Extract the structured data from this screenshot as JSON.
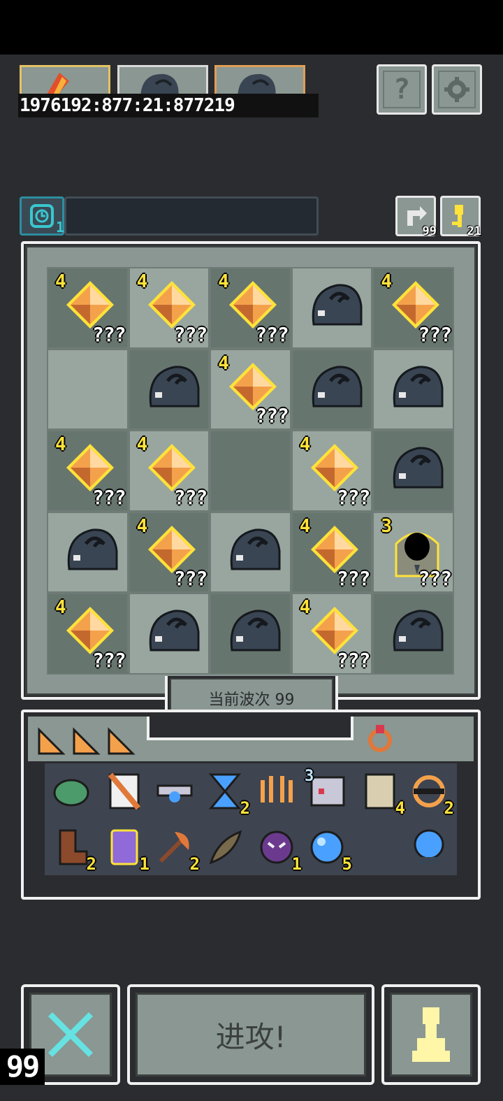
{
  "heroes": [
    {
      "name": "hero-red",
      "border": "#e3c266",
      "stat": "19761"
    },
    {
      "name": "hero-dark-1",
      "border": "#d9d9d9",
      "stat": "92:877"
    },
    {
      "name": "hero-dark-2",
      "border": "#e09e58",
      "stat": "21:877219"
    }
  ],
  "hero_stats_text": "1976192:877:21:877219",
  "help_label": "?",
  "timer": {
    "count": "1",
    "progress": 0.0
  },
  "resources": {
    "reroll": "99",
    "keys": "21"
  },
  "board": [
    [
      "gem",
      "gem",
      "gem",
      "slime",
      "gem"
    ],
    [
      "empty",
      "slime",
      "gem",
      "slime",
      "slime"
    ],
    [
      "gem",
      "gem",
      "empty",
      "gem",
      "slime"
    ],
    [
      "slime",
      "gem",
      "slime",
      "gem",
      "portal"
    ],
    [
      "gem",
      "slime",
      "slime",
      "gem",
      "slime"
    ]
  ],
  "gem_level": "4",
  "portal_level": "3",
  "unknown_label": "???",
  "wave_label": "当前波次 99",
  "inventory": {
    "row1": [
      {
        "icon": "turtle-shell-icon",
        "count": ""
      },
      {
        "icon": "flag-icon",
        "count": ""
      },
      {
        "icon": "goggles-icon",
        "count": ""
      },
      {
        "icon": "hourglass-icon",
        "count": "2"
      },
      {
        "icon": "claw-icon",
        "count": ""
      },
      {
        "icon": "book-icon",
        "count": "",
        "pre": "3"
      },
      {
        "icon": "map-icon",
        "count": "4"
      },
      {
        "icon": "shield-ring-icon",
        "count": "2"
      }
    ],
    "row2": [
      {
        "icon": "boot-icon",
        "count": "2"
      },
      {
        "icon": "potion-jar-icon",
        "count": "1"
      },
      {
        "icon": "axe-icon",
        "count": "2"
      },
      {
        "icon": "feather-icon",
        "count": ""
      },
      {
        "icon": "demon-mask-icon",
        "count": "1"
      },
      {
        "icon": "blue-orb-icon",
        "count": "5"
      },
      {
        "icon": "crystal-ball-icon",
        "count": ""
      }
    ]
  },
  "bottom": {
    "attack_label": "进攻!",
    "corner_counter": "99"
  },
  "colors": {
    "background": "#2b2c30",
    "panel": "#8a9792",
    "gem": "#f4a14c",
    "level": "#ffe23a",
    "accent": "#39c7d0"
  }
}
